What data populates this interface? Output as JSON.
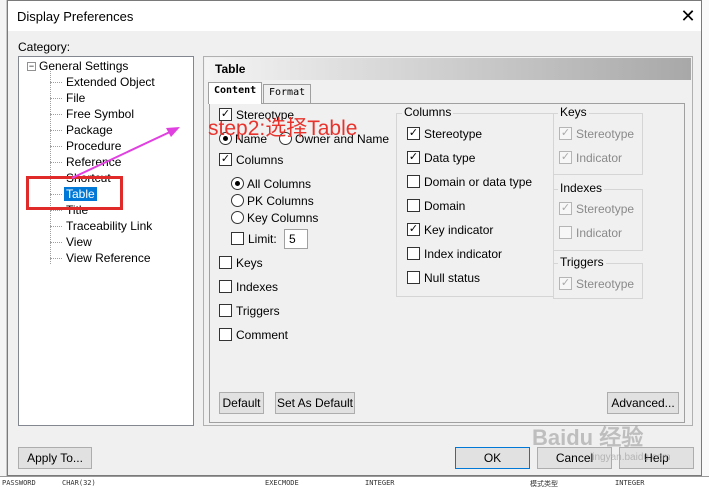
{
  "dialog": {
    "title": "Display Preferences",
    "category_label": "Category:"
  },
  "tree": {
    "root": "General Settings",
    "items": [
      {
        "label": "Extended Object"
      },
      {
        "label": "File"
      },
      {
        "label": "Free Symbol"
      },
      {
        "label": "Package"
      },
      {
        "label": "Procedure"
      },
      {
        "label": "Reference"
      },
      {
        "label": "Shortcut"
      },
      {
        "label": "Table",
        "selected": true
      },
      {
        "label": "Title"
      },
      {
        "label": "Traceability Link"
      },
      {
        "label": "View"
      },
      {
        "label": "View Reference"
      }
    ]
  },
  "panel": {
    "header": "Table",
    "tabs": {
      "content": "Content",
      "format": "Format"
    },
    "left": {
      "stereotype": "Stereotype",
      "name": "Name",
      "owner_and_name": "Owner and Name",
      "columns": "Columns",
      "all_columns": "All Columns",
      "pk_columns": "PK Columns",
      "key_columns": "Key Columns",
      "limit": "Limit:",
      "limit_value": "5",
      "keys": "Keys",
      "indexes": "Indexes",
      "triggers": "Triggers",
      "comment": "Comment"
    },
    "columns_group": {
      "title": "Columns",
      "stereotype": "Stereotype",
      "data_type": "Data type",
      "domain_or_data_type": "Domain or data type",
      "domain": "Domain",
      "key_indicator": "Key indicator",
      "index_indicator": "Index indicator",
      "null_status": "Null status"
    },
    "keys_group": {
      "title": "Keys",
      "stereotype": "Stereotype",
      "indicator": "Indicator"
    },
    "indexes_group": {
      "title": "Indexes",
      "stereotype": "Stereotype",
      "indicator": "Indicator"
    },
    "triggers_group": {
      "title": "Triggers",
      "stereotype": "Stereotype"
    },
    "buttons": {
      "default": "Default",
      "set_as_default": "Set As Default",
      "advanced": "Advanced..."
    }
  },
  "footer": {
    "apply_to": "Apply To...",
    "ok": "OK",
    "cancel": "Cancel",
    "help": "Help"
  },
  "annotation": {
    "text": "step2:选择Table",
    "color": "#e8332d"
  },
  "watermark": {
    "text": "Baidu 经验",
    "sub": "jingyan.baidu.com"
  },
  "background_text": {
    "b1": "PASSWORD",
    "b2": "CHAR(32)",
    "b3": "EXECMODE",
    "b4": "INTEGER",
    "b5": "模式类型",
    "b6": "INTEGER"
  },
  "colors": {
    "selection": "#0078d7",
    "annotation_red": "#e02a2a",
    "arrow_magenta": "#e040e0"
  }
}
